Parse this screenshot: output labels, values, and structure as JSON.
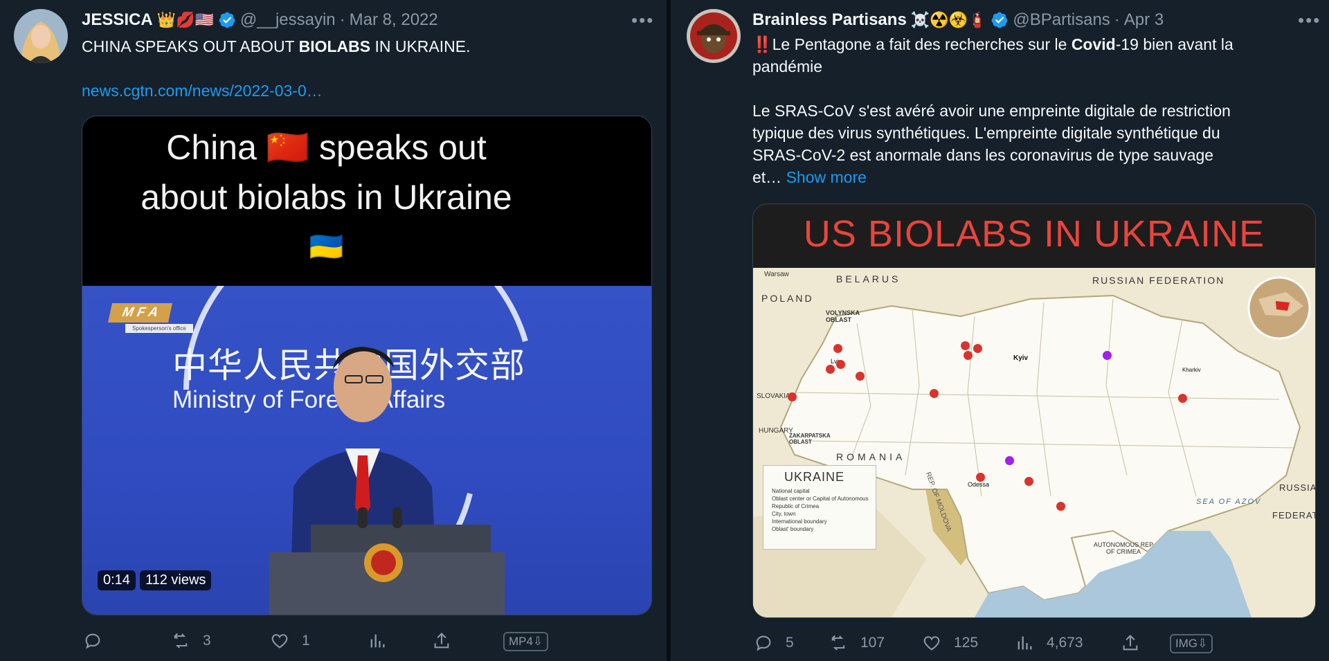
{
  "tweet1": {
    "author": {
      "name": "JESSICA",
      "emojis": "👑💋🇺🇸",
      "handle": "@__jessayin",
      "separator": "·",
      "date": "Mar 8, 2022"
    },
    "text_prefix": "CHINA SPEAKS OUT ABOUT ",
    "text_bold": "BIOLABS",
    "text_suffix": " IN UKRAINE.",
    "link": "news.cgtn.com/news/2022-03-0…",
    "video": {
      "caption_line1": "China 🇨🇳 speaks out",
      "caption_line2": "about biolabs in Ukraine",
      "flag": "🇺🇦",
      "backdrop_chinese": "中华人民共和国外交部",
      "backdrop_english": "Ministry of Foreign Affairs",
      "mfa_badge": "M F A",
      "mfa_sub": "Spokesperson's office",
      "duration": "0:14",
      "views": "112 views"
    },
    "actions": {
      "replies": "",
      "retweets": "3",
      "likes": "1",
      "views": "",
      "download": "MP4⇩"
    }
  },
  "tweet2": {
    "author": {
      "name": "Brainless Partisans",
      "emojis": "☠️☢️☣️🧯",
      "handle": "@BPartisans",
      "separator": "·",
      "date": "Apr 3"
    },
    "line1_prefix": "‼️Le Pentagone a fait des recherches sur le ",
    "line1_bold": "Covid",
    "line1_suffix": "-19 bien avant la",
    "line2": "pandémie",
    "line3": "Le SRAS-CoV s'est avéré avoir une empreinte digitale de restriction",
    "line4": "typique des virus synthétiques. L'empreinte digitale synthétique du",
    "line5": "SRAS-CoV-2 est anormale dans les coronavirus de type sauvage",
    "line6": "et…",
    "show_more": "Show more",
    "map": {
      "title": "US BIOLABS IN UKRAINE",
      "label_warsaw": "Warsaw",
      "label_poland": "POLAND",
      "label_belarus": "BELARUS",
      "label_russia": "RUSSIAN FEDERATION",
      "label_slovakia": "SLOVAKIA",
      "label_hungary": "HUNGARY",
      "label_romania": "ROMANIA",
      "label_moldova": "REP. OF MOLDOVA",
      "label_sea_azov": "SEA OF AZOV",
      "label_russian2": "RUSSIAN",
      "label_federation2": "FEDERATION",
      "label_kyiv": "Kyiv",
      "label_kharkiv": "Kharkiv",
      "label_odesa": "Odessa",
      "label_lviv": "Lviv",
      "label_crimea": "AUTONOMOUS REP OF CRIMEA",
      "label_volynska": "VOLYNSKA OBLAST",
      "label_zakarpatska": "ZAKARPATSKA OBLAST",
      "legend_title": "UKRAINE",
      "legend_items": [
        "National capital",
        "Oblast center or Capital of Autonomous Republic of Crimea",
        "City, town",
        "International boundary",
        "Oblast' boundary"
      ]
    },
    "actions": {
      "replies": "5",
      "retweets": "107",
      "likes": "125",
      "views": "4,673",
      "download": "IMG⇩"
    }
  },
  "colors": {
    "background": "#15202b",
    "text": "#f7f9f9",
    "muted": "#8b98a5",
    "link": "#1d9bf0",
    "verified": "#1d9bf0",
    "map_title": "#e8453c",
    "biolab_dot": "#d9342b",
    "biolab_dot_alt": "#a020f0"
  }
}
